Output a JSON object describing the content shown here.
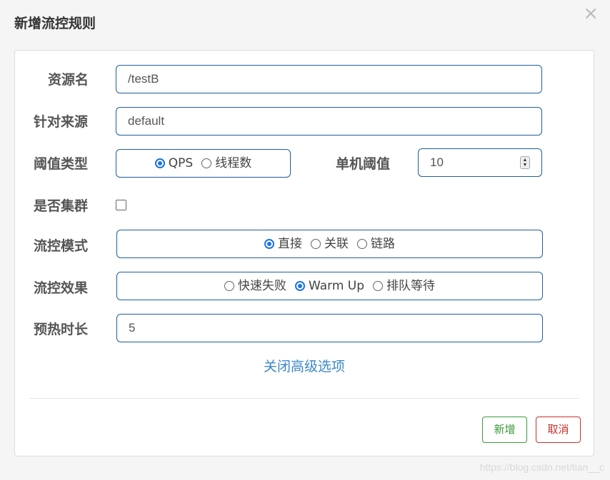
{
  "dialog": {
    "title": "新增流控规则",
    "close_glyph": "×"
  },
  "form": {
    "resource_label": "资源名",
    "resource_value": "/testB",
    "source_label": "针对来源",
    "source_value": "default",
    "threshold_type_label": "阈值类型",
    "threshold_type_options": [
      "QPS",
      "线程数"
    ],
    "threshold_type_selected": "QPS",
    "single_threshold_label": "单机阈值",
    "single_threshold_value": "10",
    "cluster_label": "是否集群",
    "cluster_checked": false,
    "mode_label": "流控模式",
    "mode_options": [
      "直接",
      "关联",
      "链路"
    ],
    "mode_selected": "直接",
    "effect_label": "流控效果",
    "effect_options": [
      "快速失败",
      "Warm Up",
      "排队等待"
    ],
    "effect_selected": "Warm Up",
    "warmup_label": "预热时长",
    "warmup_value": "5"
  },
  "advanced_link": "关闭高级选项",
  "buttons": {
    "add": "新增",
    "cancel": "取消"
  },
  "watermark": "https://blog.csdn.net/tian__c",
  "colors": {
    "accent": "#1a73e8",
    "field_border": "#1f5f9a",
    "link": "#3a87c8",
    "add_button": "#3a9b3a",
    "cancel_button": "#c9302c"
  }
}
